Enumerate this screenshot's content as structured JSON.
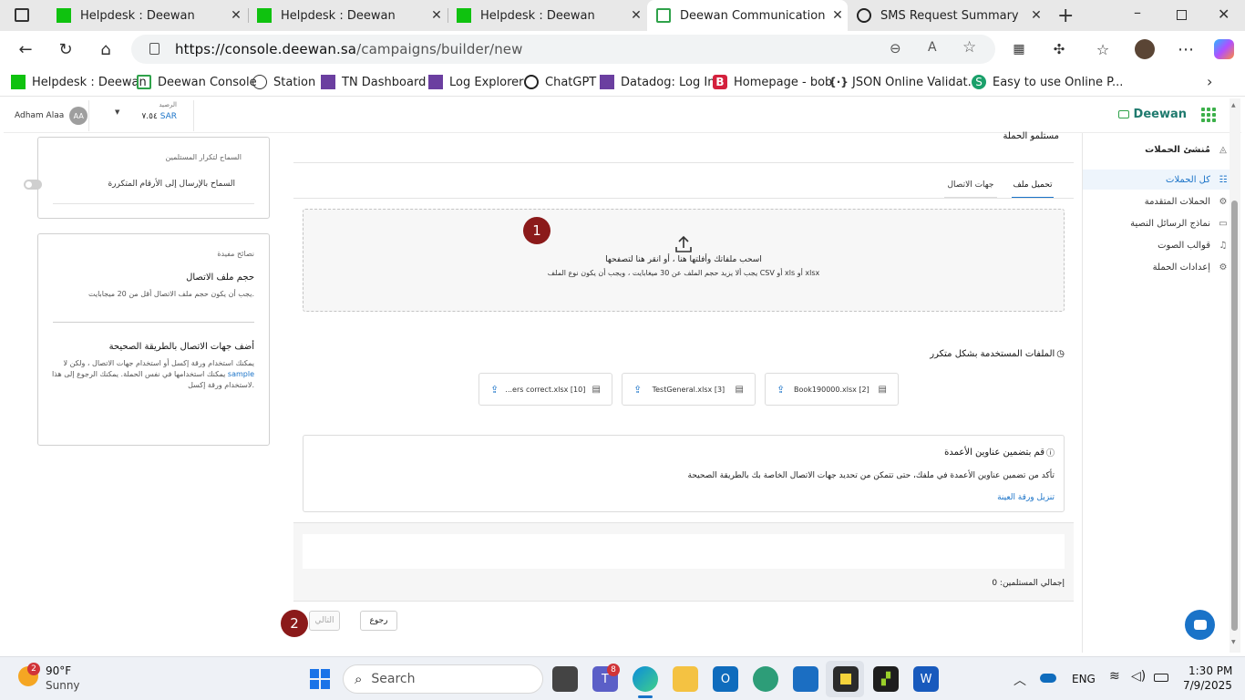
{
  "browser": {
    "tabs": [
      {
        "title": "Helpdesk : Deewan",
        "active": false
      },
      {
        "title": "Helpdesk : Deewan",
        "active": false
      },
      {
        "title": "Helpdesk : Deewan",
        "active": false
      },
      {
        "title": "Deewan Communication Platf",
        "active": true
      },
      {
        "title": "SMS Request Summary",
        "active": false
      }
    ],
    "url_host": "https://console.deewan.sa",
    "url_path": "/campaigns/builder/new",
    "bookmarks": [
      "Helpdesk : Deewan",
      "Deewan Console",
      "Station",
      "TN Dashboard",
      "Log Explorer",
      "ChatGPT",
      "Datadog: Log In",
      "Homepage - bob",
      "JSON Online Validat...",
      "Easy to use Online P..."
    ]
  },
  "header": {
    "user_name": "Adham Alaa",
    "user_initials": "AA",
    "balance_label": "الرصيد",
    "balance_value": "٧.٥٤",
    "currency": "SAR",
    "brand": "Deewan"
  },
  "sidebar": {
    "title": "مُنشئ الحملات",
    "items": [
      {
        "label": "كل الحملات",
        "active": true
      },
      {
        "label": "الحملات المتقدمة",
        "active": false
      },
      {
        "label": "نماذج الرسائل النصية",
        "active": false
      },
      {
        "label": "قوالب الصوت",
        "active": false
      },
      {
        "label": "إعدادات الحملة",
        "active": false
      }
    ]
  },
  "duplicates_panel": {
    "title": "السماح لتكرار المستلمين",
    "toggle_label": "السماح بالإرسال إلى الأرقام المتكررة"
  },
  "tips_panel": {
    "title": "نصائح مفيدة",
    "tip1_title": "حجم ملف الاتصال",
    "tip1_body": "يجب أن يكون حجم ملف الاتصال أقل من 20 ميجابايت.",
    "tip2_title": "أضف جهات الاتصال بالطريقة الصحيحة",
    "tip2_body_line1": "يمكنك استخدام ورقة إكسل أو استخدام جهات الاتصال ، ولكن لا",
    "tip2_body_line2_pre": "يمكنك استخدامها في نفس الحملة. يمكنك الرجوع إلى هذا",
    "tip2_link": "sample",
    "tip2_body_line3": "لاستخدام ورقة إكسل."
  },
  "main": {
    "section_title": "مستلمو الحملة",
    "tabs": [
      {
        "label": "تحميل ملف",
        "active": true
      },
      {
        "label": "جهات الاتصال",
        "active": false
      }
    ],
    "upload_line1": "اسحب ملفاتك وأفلتها هنا ، أو انقر هنا لتصفحها",
    "upload_line2": "يجب ألا يزيد حجم الملف عن 30 ميغابايت ، ويجب أن يكون نوع الملف CSV أو xls أو xlsx",
    "recent_title": "الملفات المستخدمة بشكل متكرر",
    "recent_files": [
      {
        "name": "Book190000.xlsx [2]"
      },
      {
        "name": "TestGeneral.xlsx [3]"
      },
      {
        "name": "...ers correct.xlsx [10]"
      }
    ],
    "info_title": "قم بتضمين عناوين الأعمدة",
    "info_body": "تأكد من تضمين عناوين الأعمدة في ملفك، حتى تتمكن من تحديد جهات الاتصال الخاصة بك بالطريقة الصحيحة",
    "info_link": "تنزيل ورقة العينة",
    "total_recipients": "إجمالي المستلمين: 0",
    "back_label": "رجوع",
    "next_label": "التالي",
    "marker1": "1",
    "marker2": "2"
  },
  "taskbar": {
    "weather_temp": "90°F",
    "weather_desc": "Sunny",
    "weather_badge": "2",
    "search_placeholder": "Search",
    "teams_badge": "8",
    "lang": "ENG",
    "time": "1:30 PM",
    "date": "7/9/2025"
  }
}
